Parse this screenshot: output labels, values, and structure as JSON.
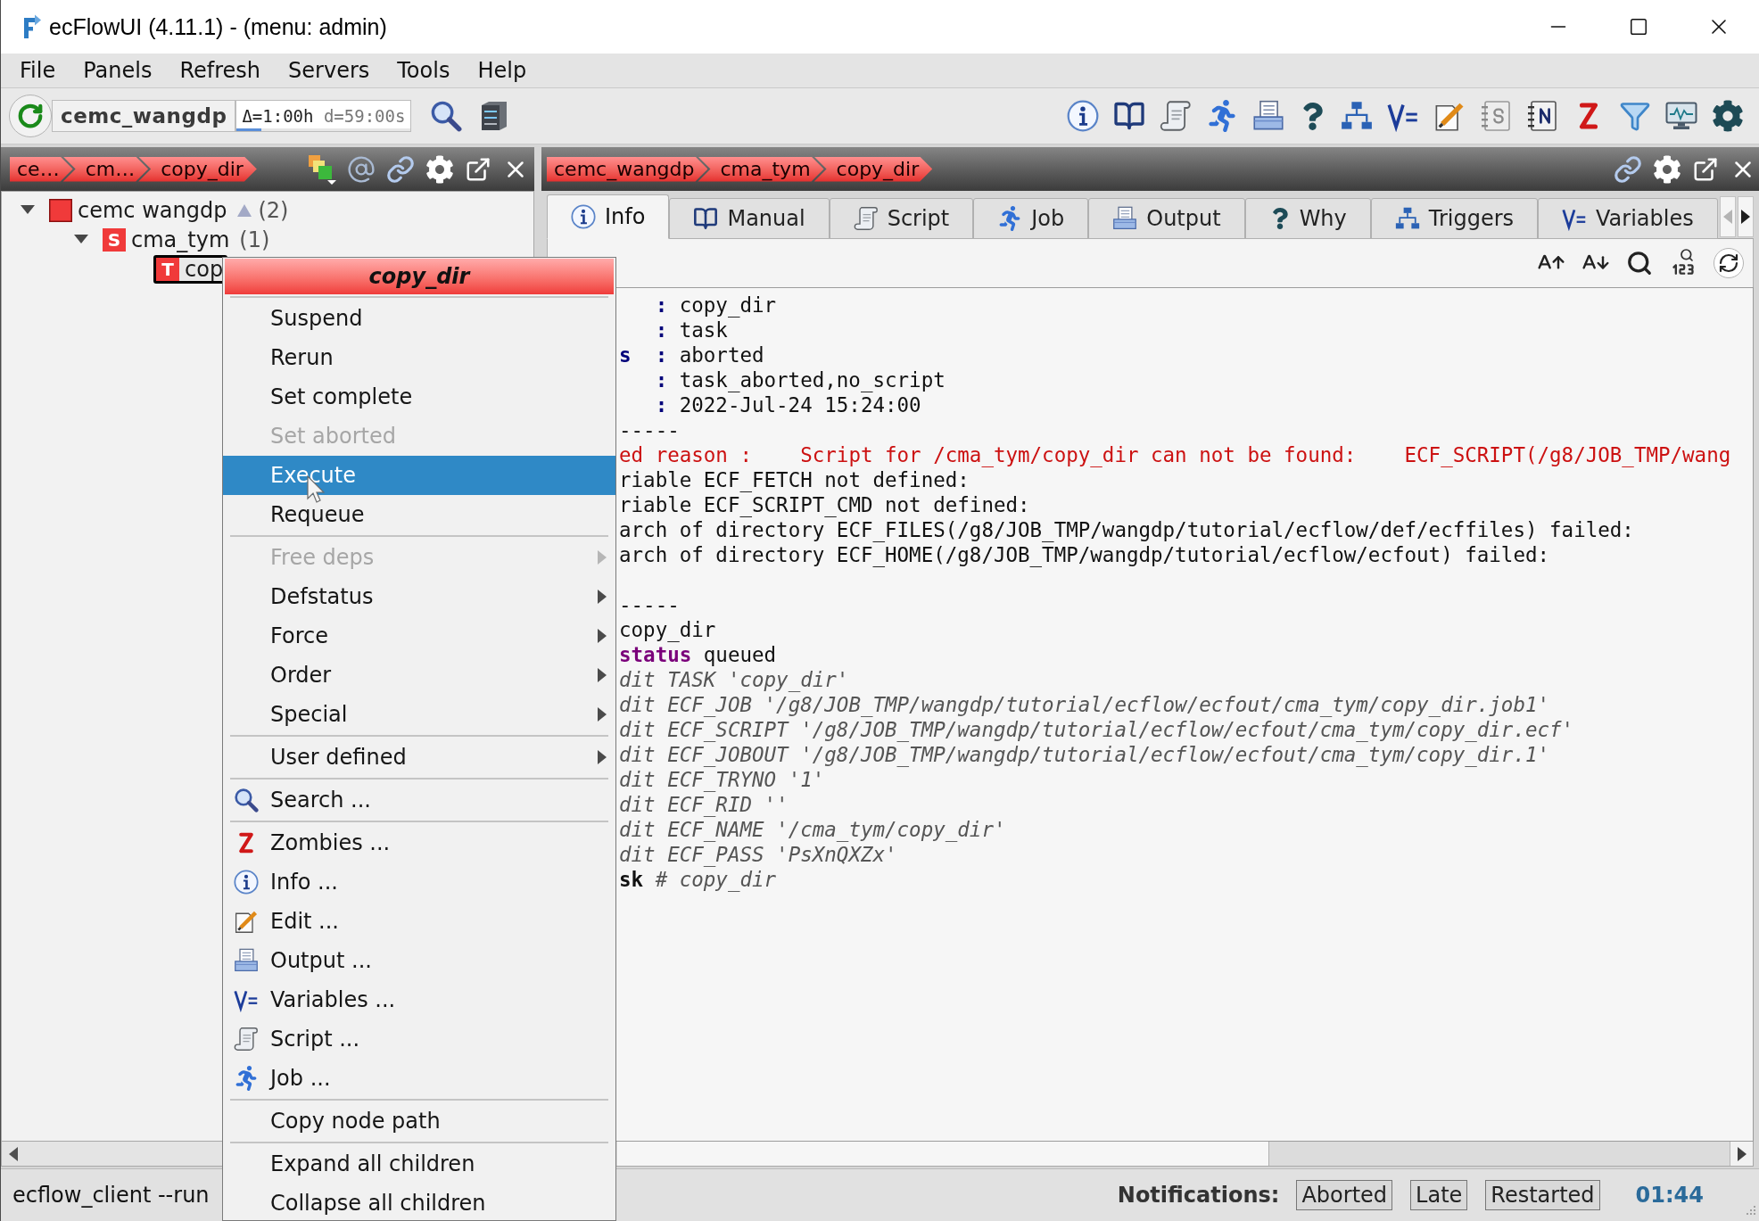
{
  "window": {
    "title": "ecFlowUI (4.11.1) - (menu: admin)"
  },
  "menu_bar": [
    "File",
    "Panels",
    "Refresh",
    "Servers",
    "Tools",
    "Help"
  ],
  "toolbar": {
    "server": "cemc_wangdp",
    "delta": "Δ=1:00h",
    "period": "d=59:00s",
    "refresh_progress": {
      "level": 0.14
    }
  },
  "left_panel": {
    "breadcrumbs": [
      "ce…",
      "cm…",
      "copy_dir"
    ],
    "tree": [
      {
        "kind": "server",
        "label": "cemc wangdp",
        "count": "(2)",
        "color": "#f03a3a",
        "expanded": true,
        "selected": false,
        "children": [
          {
            "kind": "suite",
            "badge": "S",
            "label": "cma_tym",
            "count": "(1)",
            "color": "#f03a3a",
            "expanded": true,
            "selected": false,
            "children": [
              {
                "kind": "task",
                "badge": "T",
                "label": "cop",
                "color": "#f03a3a",
                "selected": true
              }
            ]
          }
        ]
      }
    ]
  },
  "right_panel": {
    "breadcrumbs": [
      "cemc_wangdp",
      "cma_tym",
      "copy_dir"
    ],
    "tabs": [
      {
        "kind": "info",
        "label": "Info",
        "selected": true
      },
      {
        "kind": "manual",
        "label": "Manual",
        "selected": false
      },
      {
        "kind": "script",
        "label": "Script",
        "selected": false
      },
      {
        "kind": "job",
        "label": "Job",
        "selected": false
      },
      {
        "kind": "output",
        "label": "Output",
        "selected": false
      },
      {
        "kind": "why",
        "label": "Why",
        "selected": false
      },
      {
        "kind": "triggers",
        "label": "Triggers",
        "selected": false
      },
      {
        "kind": "variables",
        "label": "Variables",
        "selected": false
      }
    ],
    "tab_scroll": [
      {
        "kind": "left",
        "disabled": true
      },
      {
        "kind": "right",
        "disabled": false
      }
    ],
    "info_text": [
      {
        "kind": "attr",
        "sep": ":",
        "value": "copy_dir"
      },
      {
        "kind": "attr",
        "sep": ":",
        "value": "task"
      },
      {
        "kind": "attr",
        "key": "s",
        "sep": ":",
        "value": "aborted"
      },
      {
        "kind": "attr",
        "sep": ":",
        "value": "task_aborted,no_script"
      },
      {
        "kind": "attr",
        "sep": ":",
        "value": "2022-Jul-24 15:24:00"
      },
      {
        "kind": "plain",
        "text": "-----"
      },
      {
        "kind": "error",
        "text": "ed reason :    Script for /cma_tym/copy_dir can not be found:    ECF_SCRIPT(/g8/JOB_TMP/wang"
      },
      {
        "kind": "plain",
        "text": "riable ECF_FETCH not defined:"
      },
      {
        "kind": "plain",
        "text": "riable ECF_SCRIPT_CMD not defined:"
      },
      {
        "kind": "plain",
        "text": "arch of directory ECF_FILES(/g8/JOB_TMP/wangdp/tutorial/ecflow/def/ecffiles) failed:"
      },
      {
        "kind": "plain",
        "text": "arch of directory ECF_HOME(/g8/JOB_TMP/wangdp/tutorial/ecflow/ecfout) failed:"
      },
      {
        "kind": "blank"
      },
      {
        "kind": "plain",
        "text": "-----"
      },
      {
        "kind": "plain",
        "text": "copy_dir"
      },
      {
        "kind": "keyword",
        "keyword": "status",
        "text": "queued"
      },
      {
        "kind": "comment",
        "text": "dit TASK 'copy_dir'"
      },
      {
        "kind": "comment",
        "text": "dit ECF_JOB '/g8/JOB_TMP/wangdp/tutorial/ecflow/ecfout/cma_tym/copy_dir.job1'"
      },
      {
        "kind": "comment",
        "text": "dit ECF_SCRIPT '/g8/JOB_TMP/wangdp/tutorial/ecflow/ecfout/cma_tym/copy_dir.ecf'"
      },
      {
        "kind": "comment",
        "text": "dit ECF_JOBOUT '/g8/JOB_TMP/wangdp/tutorial/ecflow/ecfout/cma_tym/copy_dir.1'"
      },
      {
        "kind": "comment",
        "text": "dit ECF_TRYNO '1'"
      },
      {
        "kind": "comment",
        "text": "dit ECF_RID ''"
      },
      {
        "kind": "comment",
        "text": "dit ECF_NAME '/cma_tym/copy_dir'"
      },
      {
        "kind": "comment",
        "text": "dit ECF_PASS 'PsXnQXZx'"
      },
      {
        "kind": "end",
        "keyword": "sk",
        "text": "# copy_dir"
      }
    ]
  },
  "context_menu": {
    "title": "copy_dir",
    "sections": [
      [
        {
          "kind": "plain",
          "label": "Suspend",
          "disabled": false,
          "highlighted": false,
          "submenu": false
        },
        {
          "kind": "plain",
          "label": "Rerun",
          "disabled": false,
          "highlighted": false,
          "submenu": false
        },
        {
          "kind": "plain",
          "label": "Set complete",
          "disabled": false,
          "highlighted": false,
          "submenu": false
        },
        {
          "kind": "plain",
          "label": "Set aborted",
          "disabled": true,
          "highlighted": false,
          "submenu": false
        },
        {
          "kind": "plain",
          "label": "Execute",
          "disabled": false,
          "highlighted": true,
          "submenu": false
        },
        {
          "kind": "plain",
          "label": "Requeue",
          "disabled": false,
          "highlighted": false,
          "submenu": false
        }
      ],
      [
        {
          "kind": "plain",
          "label": "Free deps",
          "disabled": true,
          "highlighted": false,
          "submenu": true
        },
        {
          "kind": "plain",
          "label": "Defstatus",
          "disabled": false,
          "highlighted": false,
          "submenu": true
        },
        {
          "kind": "plain",
          "label": "Force",
          "disabled": false,
          "highlighted": false,
          "submenu": true
        },
        {
          "kind": "plain",
          "label": "Order",
          "disabled": false,
          "highlighted": false,
          "submenu": true
        },
        {
          "kind": "plain",
          "label": "Special",
          "disabled": false,
          "highlighted": false,
          "submenu": true
        }
      ],
      [
        {
          "kind": "plain",
          "label": "User defined",
          "disabled": false,
          "highlighted": false,
          "submenu": true
        }
      ],
      [
        {
          "kind": "search",
          "label": "Search ...",
          "disabled": false,
          "highlighted": false,
          "submenu": false
        }
      ],
      [
        {
          "kind": "zombies",
          "label": "Zombies ...",
          "disabled": false,
          "highlighted": false,
          "submenu": false
        },
        {
          "kind": "info",
          "label": "Info ...",
          "disabled": false,
          "highlighted": false,
          "submenu": false
        },
        {
          "kind": "edit",
          "label": "Edit ...",
          "disabled": false,
          "highlighted": false,
          "submenu": false
        },
        {
          "kind": "output",
          "label": "Output ...",
          "disabled": false,
          "highlighted": false,
          "submenu": false
        },
        {
          "kind": "variables",
          "label": "Variables ...",
          "disabled": false,
          "highlighted": false,
          "submenu": false
        },
        {
          "kind": "script",
          "label": "Script ...",
          "disabled": false,
          "highlighted": false,
          "submenu": false
        },
        {
          "kind": "job",
          "label": "Job ...",
          "disabled": false,
          "highlighted": false,
          "submenu": false
        }
      ],
      [
        {
          "kind": "plain",
          "label": "Copy node path",
          "disabled": false,
          "highlighted": false,
          "submenu": false
        }
      ],
      [
        {
          "kind": "plain",
          "label": "Expand all children",
          "disabled": false,
          "highlighted": false,
          "submenu": false
        },
        {
          "kind": "plain",
          "label": "Collapse all children",
          "disabled": false,
          "highlighted": false,
          "submenu": false
        }
      ]
    ]
  },
  "status_bar": {
    "message": "ecflow_client --run",
    "notifications_label": "Notifications:",
    "notifications": [
      "Aborted",
      "Late",
      "Restarted"
    ],
    "time": "01:44"
  }
}
